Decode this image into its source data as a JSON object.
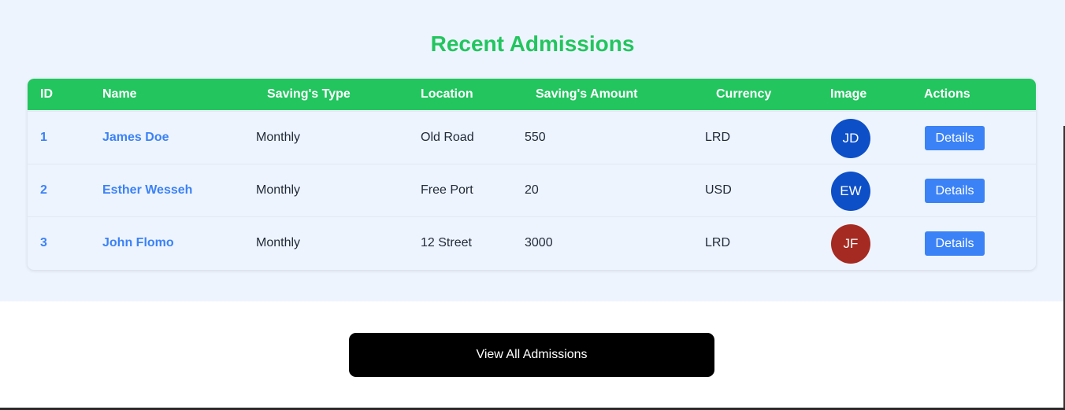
{
  "title": "Recent Admissions",
  "colors": {
    "accent": "#22c55e",
    "link": "#3b82f6",
    "section_bg": "#eef4fe",
    "avatar_blue": "#0d4fc7",
    "avatar_red": "#a52a22"
  },
  "table": {
    "headers": [
      "ID",
      "Name",
      "Saving's Type",
      "Location",
      "Saving's Amount",
      "Currency",
      "Image",
      "Actions"
    ],
    "rows": [
      {
        "id": "1",
        "name": "James Doe",
        "type": "Monthly",
        "location": "Old Road",
        "amount": "550",
        "currency": "LRD",
        "initials": "JD",
        "avatar_color": "#0d4fc7",
        "action": "Details"
      },
      {
        "id": "2",
        "name": "Esther Wesseh",
        "type": "Monthly",
        "location": "Free Port",
        "amount": "20",
        "currency": "USD",
        "initials": "EW",
        "avatar_color": "#0d4fc7",
        "action": "Details"
      },
      {
        "id": "3",
        "name": "John Flomo",
        "type": "Monthly",
        "location": "12 Street",
        "amount": "3000",
        "currency": "LRD",
        "initials": "JF",
        "avatar_color": "#a52a22",
        "action": "Details"
      }
    ]
  },
  "view_all_label": "View All Admissions"
}
